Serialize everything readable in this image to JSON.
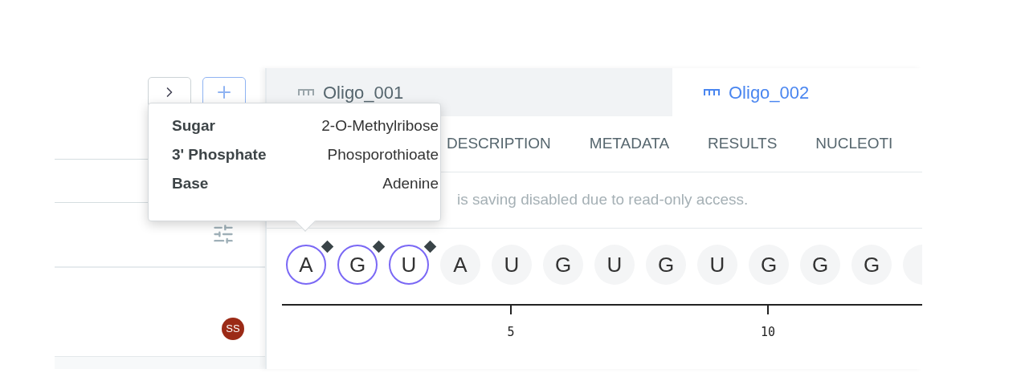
{
  "sidebar": {
    "avatar": {
      "initials": "SS",
      "color": "#9b2a16"
    }
  },
  "tabs": [
    {
      "label": "Oligo_001",
      "selected": false
    },
    {
      "label": "Oligo_002",
      "selected": true
    }
  ],
  "subtabs": [
    {
      "label": "DESCRIPTION"
    },
    {
      "label": "METADATA"
    },
    {
      "label": "RESULTS"
    },
    {
      "label": "NUCLEOTI"
    }
  ],
  "notice": "is saving disabled due to read-only access.",
  "nucleotides": [
    {
      "letter": "A",
      "selected": true,
      "modified": true
    },
    {
      "letter": "G",
      "selected": true,
      "modified": true
    },
    {
      "letter": "U",
      "selected": true,
      "modified": true
    },
    {
      "letter": "A",
      "selected": false,
      "modified": false
    },
    {
      "letter": "U",
      "selected": false,
      "modified": false
    },
    {
      "letter": "G",
      "selected": false,
      "modified": false
    },
    {
      "letter": "U",
      "selected": false,
      "modified": false
    },
    {
      "letter": "G",
      "selected": false,
      "modified": false
    },
    {
      "letter": "U",
      "selected": false,
      "modified": false
    },
    {
      "letter": "G",
      "selected": false,
      "modified": false
    },
    {
      "letter": "G",
      "selected": false,
      "modified": false
    },
    {
      "letter": "G",
      "selected": false,
      "modified": false
    }
  ],
  "axis_ticks": [
    {
      "label": "5"
    },
    {
      "label": "10"
    }
  ],
  "tooltip": [
    {
      "label": "Sugar",
      "value": "2-O-Methylribose"
    },
    {
      "label": "3' Phosphate",
      "value": "Phosporothioate"
    },
    {
      "label": "Base",
      "value": "Adenine"
    }
  ]
}
